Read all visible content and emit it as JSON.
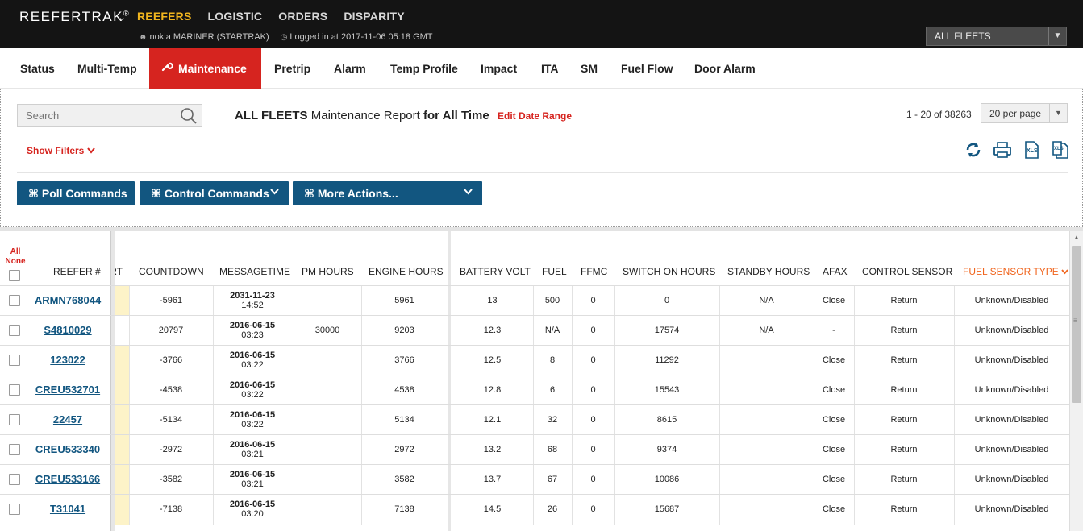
{
  "app": {
    "brand": "REEFERTRAK",
    "brand_mark": "®",
    "nav": [
      "REEFERS",
      "LOGISTIC",
      "ORDERS",
      "DISPARITY"
    ],
    "active_nav": "REEFERS",
    "user": "nokia MARINER (STARTRAK)",
    "login": "Logged in at 2017-11-06 05:18 GMT",
    "fleet_select": "ALL FLEETS"
  },
  "tabs": [
    "Status",
    "Multi-Temp",
    "Maintenance",
    "Pretrip",
    "Alarm",
    "Temp Profile",
    "Impact",
    "ITA",
    "SM",
    "Fuel Flow",
    "Door Alarm"
  ],
  "active_tab": "Maintenance",
  "report": {
    "search_placeholder": "Search",
    "title_fleet": "ALL FLEETS",
    "title_mid": "Maintenance Report",
    "title_range": "for All Time",
    "edit_range": "Edit Date Range",
    "page_count": "1 - 20 of 38263",
    "per_page": "20 per page",
    "show_filters": "Show Filters"
  },
  "actions": {
    "poll": "⌘ Poll Commands",
    "control": "⌘ Control Commands",
    "more": "⌘ More Actions..."
  },
  "columns": {
    "all": "All",
    "none": "None",
    "reefer": "REEFER #",
    "rt": "RT",
    "countdown": "COUNTDOWN",
    "messagetime": "MESSAGETIME",
    "pm_hours": "PM HOURS",
    "engine_hours": "ENGINE HOURS",
    "battery_volt": "BATTERY VOLT",
    "fuel": "FUEL",
    "ffmc": "FFMC",
    "switch_on": "SWITCH ON HOURS",
    "standby": "STANDBY HOURS",
    "afax": "AFAX",
    "control_sensor": "CONTROL SENSOR",
    "fuel_sensor_type": "FUEL SENSOR TYPE"
  },
  "rows": [
    {
      "reefer": "ARMN768044",
      "countdown": "-5961",
      "date": "2031-11-23",
      "time": "14:52",
      "pm": "",
      "engine": "5961",
      "battery": "13",
      "fuel": "500",
      "ffmc": "0",
      "switch_on": "0",
      "standby": "N/A",
      "afax": "Close",
      "control": "Return",
      "fuel_type": "Unknown/Disabled",
      "yellow": true
    },
    {
      "reefer": "S4810029",
      "countdown": "20797",
      "date": "2016-06-15",
      "time": "03:23",
      "pm": "30000",
      "engine": "9203",
      "battery": "12.3",
      "fuel": "N/A",
      "ffmc": "0",
      "switch_on": "17574",
      "standby": "N/A",
      "afax": "-",
      "control": "Return",
      "fuel_type": "Unknown/Disabled",
      "yellow": false
    },
    {
      "reefer": "123022",
      "countdown": "-3766",
      "date": "2016-06-15",
      "time": "03:22",
      "pm": "",
      "engine": "3766",
      "battery": "12.5",
      "fuel": "8",
      "ffmc": "0",
      "switch_on": "11292",
      "standby": "",
      "afax": "Close",
      "control": "Return",
      "fuel_type": "Unknown/Disabled",
      "yellow": true
    },
    {
      "reefer": "CREU532701",
      "countdown": "-4538",
      "date": "2016-06-15",
      "time": "03:22",
      "pm": "",
      "engine": "4538",
      "battery": "12.8",
      "fuel": "6",
      "ffmc": "0",
      "switch_on": "15543",
      "standby": "",
      "afax": "Close",
      "control": "Return",
      "fuel_type": "Unknown/Disabled",
      "yellow": true
    },
    {
      "reefer": "22457",
      "countdown": "-5134",
      "date": "2016-06-15",
      "time": "03:22",
      "pm": "",
      "engine": "5134",
      "battery": "12.1",
      "fuel": "32",
      "ffmc": "0",
      "switch_on": "8615",
      "standby": "",
      "afax": "Close",
      "control": "Return",
      "fuel_type": "Unknown/Disabled",
      "yellow": true
    },
    {
      "reefer": "CREU533340",
      "countdown": "-2972",
      "date": "2016-06-15",
      "time": "03:21",
      "pm": "",
      "engine": "2972",
      "battery": "13.2",
      "fuel": "68",
      "ffmc": "0",
      "switch_on": "9374",
      "standby": "",
      "afax": "Close",
      "control": "Return",
      "fuel_type": "Unknown/Disabled",
      "yellow": true
    },
    {
      "reefer": "CREU533166",
      "countdown": "-3582",
      "date": "2016-06-15",
      "time": "03:21",
      "pm": "",
      "engine": "3582",
      "battery": "13.7",
      "fuel": "67",
      "ffmc": "0",
      "switch_on": "10086",
      "standby": "",
      "afax": "Close",
      "control": "Return",
      "fuel_type": "Unknown/Disabled",
      "yellow": true
    },
    {
      "reefer": "T31041",
      "countdown": "-7138",
      "date": "2016-06-15",
      "time": "03:20",
      "pm": "",
      "engine": "7138",
      "battery": "14.5",
      "fuel": "26",
      "ffmc": "0",
      "switch_on": "15687",
      "standby": "",
      "afax": "Close",
      "control": "Return",
      "fuel_type": "Unknown/Disabled",
      "yellow": true
    }
  ],
  "colors": {
    "accent_red": "#d6241f",
    "nav_gold": "#f0b51e",
    "button_blue": "#125680",
    "sort_orange": "#f0651e"
  }
}
